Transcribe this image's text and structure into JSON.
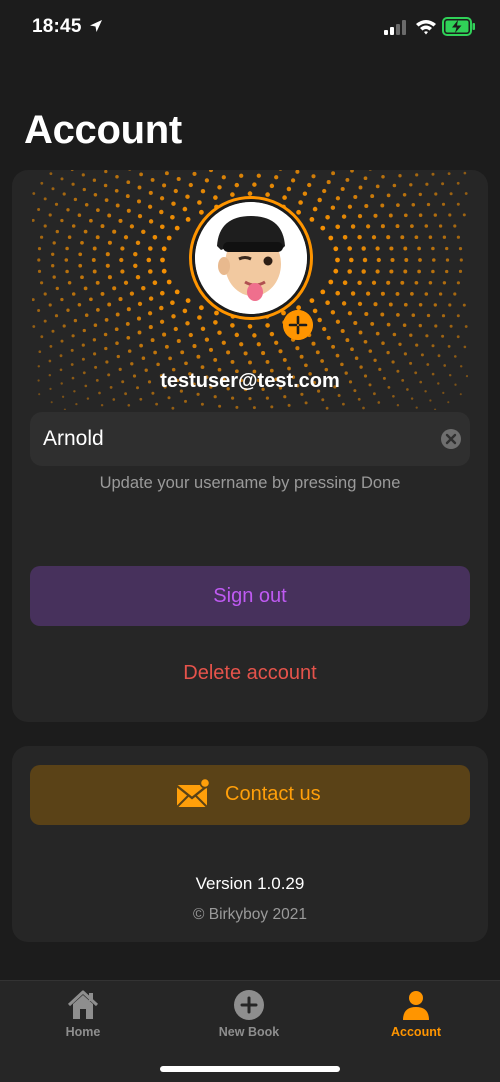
{
  "status_bar": {
    "time": "18:45"
  },
  "page": {
    "title": "Account"
  },
  "profile": {
    "email": "testuser@test.com",
    "username_value": "Arnold",
    "username_hint": "Update your username by pressing Done"
  },
  "actions": {
    "sign_out": "Sign out",
    "delete_account": "Delete account"
  },
  "contact": {
    "label": "Contact us",
    "version": "Version 1.0.29",
    "copyright": "© Birkyboy 2021"
  },
  "tabs": [
    {
      "label": "Home",
      "icon": "house-icon",
      "selected": false
    },
    {
      "label": "New Book",
      "icon": "plus-circle-icon",
      "selected": false
    },
    {
      "label": "Account",
      "icon": "person-icon",
      "selected": true
    }
  ],
  "colors": {
    "accent": "#ff9500",
    "sign_out_bg": "#47315c",
    "sign_out_text": "#bf5af2",
    "delete_text": "#e5534b",
    "contact_bg": "#5a4217",
    "contact_text": "#ff9f0a"
  }
}
